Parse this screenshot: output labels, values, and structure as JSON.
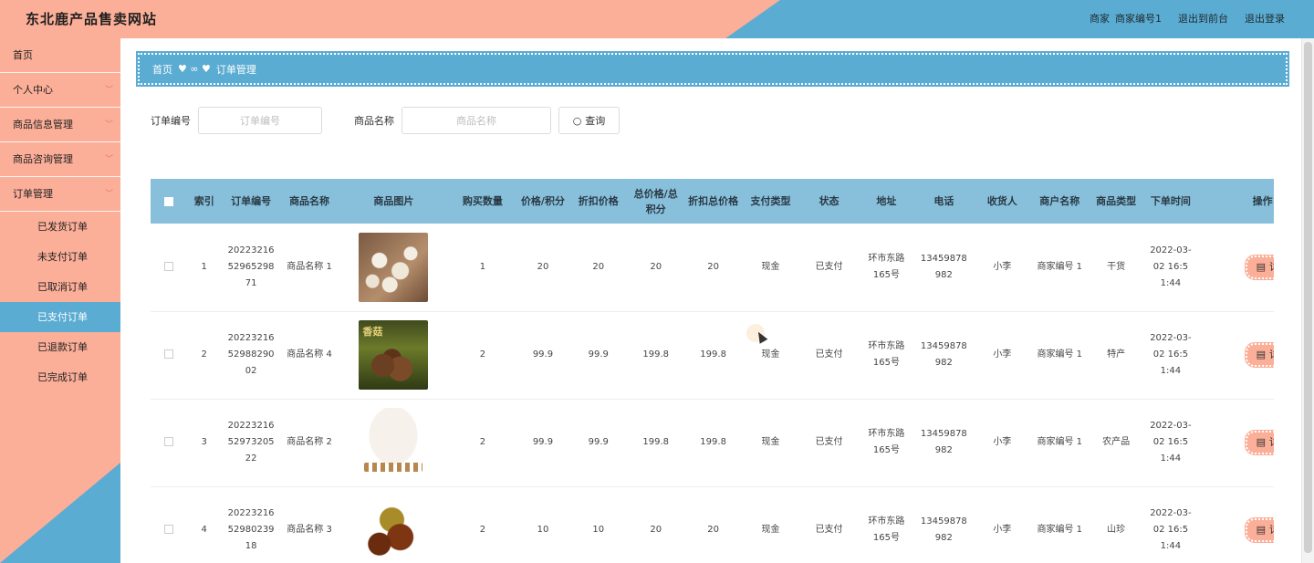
{
  "header": {
    "site_title": "东北鹿产品售卖网站",
    "role": "商家",
    "username": "商家编号1",
    "back_to_front": "退出到前台",
    "logout": "退出登录"
  },
  "sidebar": {
    "items": [
      {
        "label": "首页",
        "has_chevron": false
      },
      {
        "label": "个人中心",
        "has_chevron": true
      },
      {
        "label": "商品信息管理",
        "has_chevron": true
      },
      {
        "label": "商品咨询管理",
        "has_chevron": true
      },
      {
        "label": "订单管理",
        "has_chevron": true
      }
    ],
    "sub_items": [
      {
        "label": "已发货订单",
        "active": false
      },
      {
        "label": "未支付订单",
        "active": false
      },
      {
        "label": "已取消订单",
        "active": false
      },
      {
        "label": "已支付订单",
        "active": true
      },
      {
        "label": "已退款订单",
        "active": false
      },
      {
        "label": "已完成订单",
        "active": false
      }
    ]
  },
  "breadcrumb": {
    "home": "首页",
    "separator": "♥ ∞ ♥",
    "current": "订单管理"
  },
  "search": {
    "order_no_label": "订单编号",
    "order_no_placeholder": "订单编号",
    "product_name_label": "商品名称",
    "product_name_placeholder": "商品名称",
    "query_button": "查询"
  },
  "table": {
    "headers": [
      "索引",
      "订单编号",
      "商品名称",
      "商品图片",
      "购买数量",
      "价格/积分",
      "折扣价格",
      "总价格/总积分",
      "折扣总价格",
      "支付类型",
      "状态",
      "地址",
      "电话",
      "收货人",
      "商户名称",
      "商品类型",
      "下单时间",
      "操作"
    ],
    "detail_label": "详情",
    "rows": [
      {
        "index": "1",
        "order_no": "20223216 52965298 71",
        "name": "商品名称 1",
        "image": "img-1",
        "qty": "1",
        "price": "20",
        "discount": "20",
        "total": "20",
        "discount_total": "20",
        "pay_type": "现金",
        "status": "已支付",
        "address": "环市东路 165号",
        "phone": "13459878 982",
        "receiver": "小李",
        "merchant": "商家编号 1",
        "type": "干货",
        "time": "2022-03- 02 16:5 1:44"
      },
      {
        "index": "2",
        "order_no": "20223216 52988290 02",
        "name": "商品名称 4",
        "image": "img-2",
        "qty": "2",
        "price": "99.9",
        "discount": "99.9",
        "total": "199.8",
        "discount_total": "199.8",
        "pay_type": "现金",
        "status": "已支付",
        "address": "环市东路 165号",
        "phone": "13459878 982",
        "receiver": "小李",
        "merchant": "商家编号 1",
        "type": "特产",
        "time": "2022-03- 02 16:5 1:44"
      },
      {
        "index": "3",
        "order_no": "20223216 52973205 22",
        "name": "商品名称 2",
        "image": "img-3",
        "qty": "2",
        "price": "99.9",
        "discount": "99.9",
        "total": "199.8",
        "discount_total": "199.8",
        "pay_type": "现金",
        "status": "已支付",
        "address": "环市东路 165号",
        "phone": "13459878 982",
        "receiver": "小李",
        "merchant": "商家编号 1",
        "type": "农产品",
        "time": "2022-03- 02 16:5 1:44"
      },
      {
        "index": "4",
        "order_no": "20223216 52980239 18",
        "name": "商品名称 3",
        "image": "img-4",
        "qty": "2",
        "price": "10",
        "discount": "10",
        "total": "20",
        "discount_total": "20",
        "pay_type": "现金",
        "status": "已支付",
        "address": "环市东路 165号",
        "phone": "13459878 982",
        "receiver": "小李",
        "merchant": "商家编号 1",
        "type": "山珍",
        "time": "2022-03- 02 16:5 1:44"
      }
    ]
  },
  "colors": {
    "accent_blue": "#5bacd2",
    "accent_salmon": "#fbae98",
    "table_header": "#88c0dc"
  }
}
